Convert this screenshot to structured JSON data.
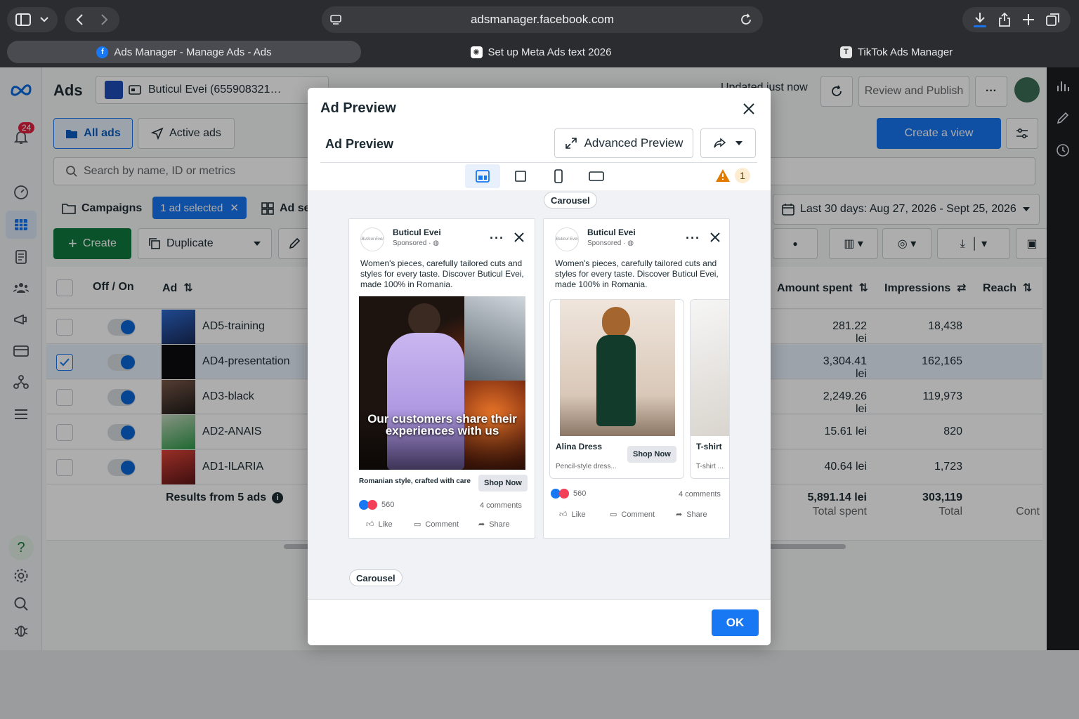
{
  "browser": {
    "url": "adsmanager.facebook.com",
    "tabs": [
      {
        "label": "Ads Manager - Manage Ads - Ads"
      },
      {
        "label": "Set up Meta Ads text 2026"
      },
      {
        "label": "TikTok Ads Manager"
      }
    ]
  },
  "nav": {
    "notification_count": "24"
  },
  "header": {
    "title": "Ads",
    "account": "Buticul Evei (655908321…",
    "updated": "Updated just now",
    "review_publish": "Review and Publish",
    "create_view": "Create a view",
    "all_ads": "All ads",
    "active_ads": "Active ads",
    "search_placeholder": "Search by name, ID or metrics",
    "campaigns": "Campaigns",
    "selected_chip": "1 ad selected",
    "ad_sets": "Ad se",
    "date_range": "Last 30 days: Aug 27, 2026 - Sept 25, 2026",
    "create": "Create",
    "duplicate": "Duplicate"
  },
  "table": {
    "columns": {
      "off_on": "Off / On",
      "ad": "Ad",
      "amount_spent": "Amount spent",
      "impressions": "Impressions",
      "reach": "Reach"
    },
    "rows": [
      {
        "name": "AD5-training",
        "spent": "281.22 lei",
        "impressions": "18,438"
      },
      {
        "name": "AD4-presentation",
        "spent": "3,304.41 lei",
        "impressions": "162,165"
      },
      {
        "name": "AD3-black",
        "spent": "2,249.26 lei",
        "impressions": "119,973"
      },
      {
        "name": "AD2-ANAIS",
        "spent": "15.61 lei",
        "impressions": "820"
      },
      {
        "name": "AD1-ILARIA",
        "spent": "40.64 lei",
        "impressions": "1,723"
      }
    ],
    "summary": {
      "results": "Results from 5 ads",
      "total_spent_value": "5,891.14 lei",
      "total_spent_label": "Total spent",
      "total_impressions_value": "303,119",
      "total_impressions_label": "Total",
      "reach_label": "Cont"
    }
  },
  "modal": {
    "title": "Ad Preview",
    "subtitle": "Ad Preview",
    "advanced_preview": "Advanced Preview",
    "warning_count": "1",
    "top_pill": "Carousel",
    "bottom_pill": "Carousel",
    "ok": "OK",
    "card1": {
      "page_name": "Buticul Evei",
      "sponsored": "Sponsored · ",
      "avatar_text": "Buticul Evei",
      "text": "Women's pieces, carefully tailored cuts and styles for every taste. Discover Buticul Evei, made 100% in Romania.",
      "image_caption": "Our customers share their experiences with us",
      "headline": "Romanian style, crafted with care",
      "cta": "Shop Now",
      "reactions": "560",
      "comments": "4 comments",
      "like": "Like",
      "comment": "Comment",
      "share": "Share"
    },
    "card2": {
      "page_name": "Buticul Evei",
      "sponsored": "Sponsored · ",
      "avatar_text": "Buticul Evei",
      "text": "Women's pieces, carefully tailored cuts and styles for every taste. Discover Buticul Evei, made 100% in Romania.",
      "item1_title": "Alina Dress",
      "item1_desc": "Pencil-style dress...",
      "item1_cta": "Shop Now",
      "item2_title": "T-shirt",
      "item2_desc": "T-shirt ...",
      "reactions": "560",
      "comments": "4 comments",
      "like": "Like",
      "comment": "Comment",
      "share": "Share"
    }
  },
  "colors": {
    "accent": "#1877f2",
    "ok_button": "#1877f2",
    "create_button": "#0f7a3e",
    "toggle_on": "#0a66d8"
  }
}
